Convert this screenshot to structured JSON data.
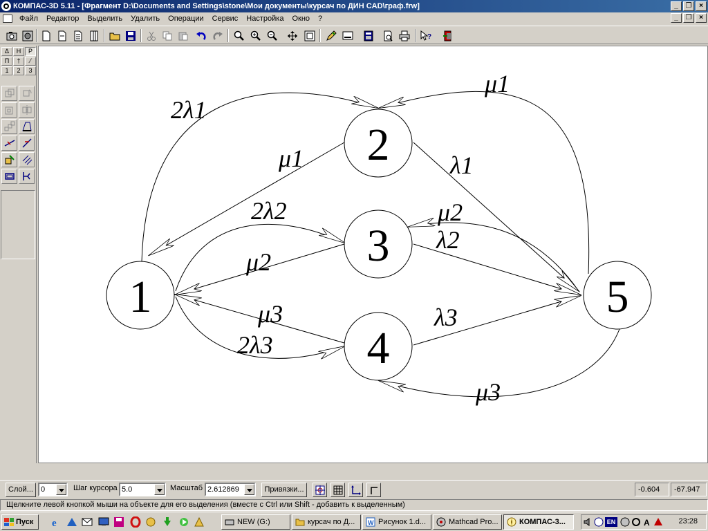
{
  "window": {
    "title": "КОМПАС-3D 5.11 - [Фрагмент D:\\Documents and Settings\\stone\\Мои документы\\курсач по ДИН CAD\\граф.frw]",
    "controls": [
      "_",
      "❐",
      "×"
    ]
  },
  "menu": {
    "items": [
      "Файл",
      "Редактор",
      "Выделить",
      "Удалить",
      "Операции",
      "Сервис",
      "Настройка",
      "Окно",
      "?"
    ],
    "doc_controls": [
      "_",
      "❐",
      "×"
    ]
  },
  "left_panel": {
    "mini_tabs": [
      "Δ",
      "H",
      "P",
      "П",
      "†",
      "⁄",
      "1",
      "2",
      "3"
    ]
  },
  "graph": {
    "nodes": [
      {
        "id": "node-1",
        "label": "1"
      },
      {
        "id": "node-2",
        "label": "2"
      },
      {
        "id": "node-3",
        "label": "3"
      },
      {
        "id": "node-4",
        "label": "4"
      },
      {
        "id": "node-5",
        "label": "5"
      }
    ],
    "edge_labels": [
      {
        "id": "e-1-2",
        "text": "2λ1"
      },
      {
        "id": "e-2-1",
        "text": "μ1"
      },
      {
        "id": "e-5-2",
        "text": "μ1"
      },
      {
        "id": "e-2-5",
        "text": "λ1"
      },
      {
        "id": "e-1-3",
        "text": "2λ2"
      },
      {
        "id": "e-3-1",
        "text": "μ2"
      },
      {
        "id": "e-5-3",
        "text": "μ2"
      },
      {
        "id": "e-3-5",
        "text": "λ2"
      },
      {
        "id": "e-4-1",
        "text": "μ3"
      },
      {
        "id": "e-1-4",
        "text": "2λ3"
      },
      {
        "id": "e-4-5",
        "text": "λ3"
      },
      {
        "id": "e-5-4",
        "text": "μ3"
      }
    ]
  },
  "property_bar": {
    "layer_button": "Слой...",
    "layer_value": "0",
    "step_label": "Шаг курсора",
    "step_value": "5.0",
    "scale_label": "Масштаб",
    "scale_value": "2.612869",
    "snaps_button": "Привязки...",
    "coord_x": "-0.604",
    "coord_y": "-67.947"
  },
  "status": {
    "hint": "Щелкните левой кнопкой мыши на объекте для его выделения (вместе с Ctrl или Shift - добавить к выделенным)"
  },
  "taskbar": {
    "start": "Пуск",
    "tasks": [
      "NEW (G:)",
      "курсач по Д...",
      "Рисунок 1.d...",
      "Mathcad Pro...",
      "КОМПАС-3..."
    ],
    "clock": "23:28",
    "lang": "EN"
  }
}
